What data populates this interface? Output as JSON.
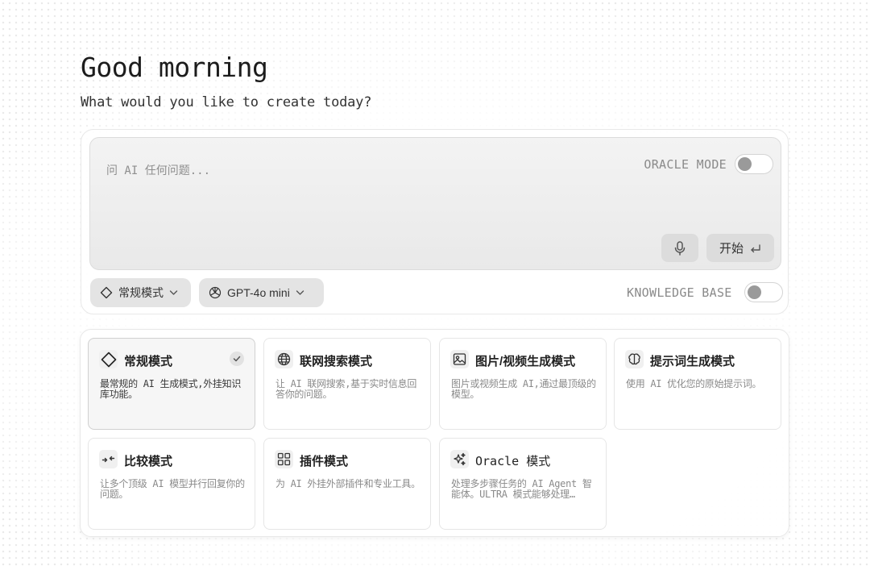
{
  "header": {
    "greeting": "Good morning",
    "subtitle": "What would you like to create today?"
  },
  "composer": {
    "placeholder": "问 AI 任何问题...",
    "oracle_mode_label": "ORACLE MODE",
    "oracle_mode_on": false,
    "start_label": "开始",
    "mode_pill_label": "常规模式",
    "model_pill_label": "GPT-4o mini",
    "knowledge_base_label": "KNOWLEDGE BASE",
    "knowledge_base_on": false
  },
  "modes": [
    {
      "title": "常规模式",
      "desc": "最常规的 AI 生成模式,外挂知识库功能。",
      "icon": "diamond-icon",
      "selected": true
    },
    {
      "title": "联网搜索模式",
      "desc": "让 AI 联网搜索,基于实时信息回答你的问题。",
      "icon": "globe-icon",
      "selected": false
    },
    {
      "title": "图片/视频生成模式",
      "desc": "图片或视频生成 AI,通过最顶级的模型。",
      "icon": "image-icon",
      "selected": false
    },
    {
      "title": "提示词生成模式",
      "desc": "使用 AI 优化您的原始提示词。",
      "icon": "brain-icon",
      "selected": false
    },
    {
      "title": "比较模式",
      "desc": "让多个顶级 AI 模型并行回复你的问题。",
      "icon": "compare-arrows-icon",
      "selected": false
    },
    {
      "title": "插件模式",
      "desc": "为 AI 外挂外部插件和专业工具。",
      "icon": "grid-icon",
      "selected": false
    },
    {
      "title": "Oracle 模式",
      "desc": "处理多步骤任务的 AI Agent 智能体。ULTRA 模式能够处理…",
      "icon": "sparkles-icon",
      "selected": false
    }
  ]
}
